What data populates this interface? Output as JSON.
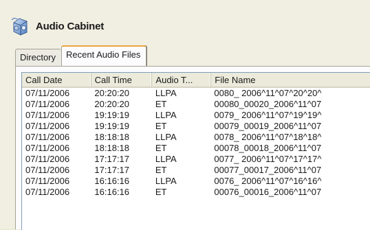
{
  "app": {
    "title": "Audio Cabinet",
    "icon": "audio-cabinet-icon"
  },
  "tabs": [
    {
      "label": "Directory",
      "active": false
    },
    {
      "label": "Recent Audio Files",
      "active": true
    }
  ],
  "table": {
    "columns": [
      "Call Date",
      "Call Time",
      "Audio T...",
      "File Name"
    ],
    "rows": [
      [
        "07/11/2006",
        "20:20:20",
        "LLPA",
        "0080_ 2006^11^07^20^20^"
      ],
      [
        "07/11/2006",
        "20:20:20",
        "ET",
        "00080_00020_2006^11^07"
      ],
      [
        "07/11/2006",
        "19:19:19",
        "LLPA",
        "0079_ 2006^11^07^19^19^"
      ],
      [
        "07/11/2006",
        "19:19:19",
        "ET",
        "00079_00019_2006^11^07"
      ],
      [
        "07/11/2006",
        "18:18:18",
        "LLPA",
        "0078_ 2006^11^07^18^18^"
      ],
      [
        "07/11/2006",
        "18:18:18",
        "ET",
        "00078_00018_2006^11^07"
      ],
      [
        "07/11/2006",
        "17:17:17",
        "LLPA",
        "0077_ 2006^11^07^17^17^"
      ],
      [
        "07/11/2006",
        "17:17:17",
        "ET",
        "00077_00017_2006^11^07"
      ],
      [
        "07/11/2006",
        "16:16:16",
        "LLPA",
        "0076_ 2006^11^07^16^16^"
      ],
      [
        "07/11/2006",
        "16:16:16",
        "ET",
        "00076_00016_2006^11^07"
      ]
    ]
  }
}
